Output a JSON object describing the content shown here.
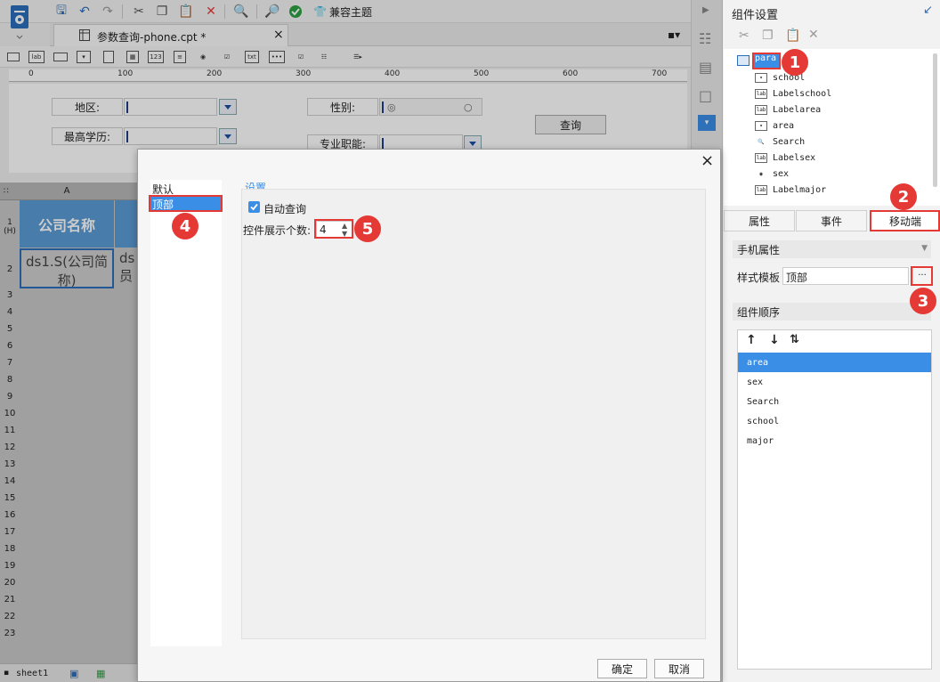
{
  "toolbar": {
    "compat_theme": "兼容主题"
  },
  "tab": {
    "title": "参数查询-phone.cpt *",
    "close": "×"
  },
  "ruler": [
    "0",
    "100",
    "200",
    "300",
    "400",
    "500",
    "600",
    "700"
  ],
  "params": {
    "area_label": "地区:",
    "edu_label": "最高学历:",
    "gender_label": "性别:",
    "major_label": "专业职能:",
    "query_button": "查询"
  },
  "sheet": {
    "col_a": "A",
    "header_cell": "公司名称",
    "cell_a2": "ds1.S(公司简称)",
    "cell_b2": "ds 员",
    "row_hdr_1": "1 (H)",
    "rows": [
      "2",
      "3",
      "4",
      "5",
      "6",
      "7",
      "8",
      "9",
      "10",
      "11",
      "12",
      "13",
      "14",
      "15",
      "16",
      "17",
      "18",
      "19",
      "20",
      "21",
      "22",
      "23"
    ],
    "sheet_tab": "sheet1"
  },
  "right_panel": {
    "title": "组件设置",
    "tree": [
      "para",
      "school",
      "Labelschool",
      "Labelarea",
      "area",
      "Search",
      "Labelsex",
      "sex",
      "Labelmajor"
    ],
    "tabs": [
      "属性",
      "事件",
      "移动端"
    ],
    "mobile_props": "手机属性",
    "style_template_label": "样式模板",
    "style_template_value": "顶部",
    "more": "...",
    "order_title": "组件顺序",
    "order_items": [
      "area",
      "sex",
      "Search",
      "school",
      "major"
    ]
  },
  "dialog": {
    "list": [
      "默认",
      "顶部"
    ],
    "section": "设置",
    "auto_query": "自动查询",
    "display_count_label": "控件展示个数:",
    "display_count_value": "4",
    "ok": "确定",
    "cancel": "取消",
    "close": "×"
  },
  "badges": [
    "1",
    "2",
    "3",
    "4",
    "5"
  ],
  "colors": {
    "accent": "#3a8ee6",
    "badge": "#e53935",
    "header_cell": "#5b9bd5"
  }
}
